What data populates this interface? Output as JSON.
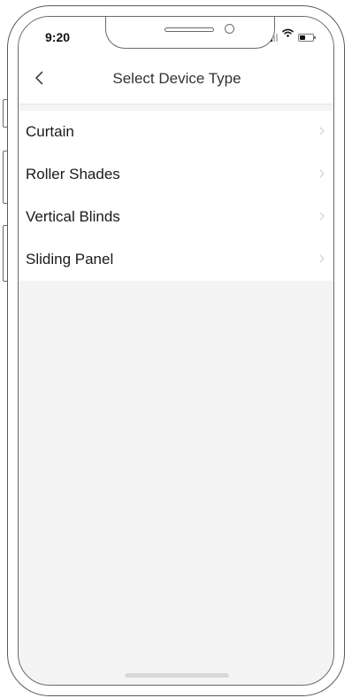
{
  "status_bar": {
    "time": "9:20",
    "icons": [
      "cellular-signal-icon",
      "wifi-icon",
      "battery-icon"
    ],
    "battery_level": 0.45
  },
  "nav": {
    "back_icon": "chevron-left-icon",
    "title": "Select Device Type"
  },
  "device_types": [
    {
      "label": "Curtain",
      "icon": "chevron-right-icon"
    },
    {
      "label": "Roller Shades",
      "icon": "chevron-right-icon"
    },
    {
      "label": "Vertical Blinds",
      "icon": "chevron-right-icon"
    },
    {
      "label": "Sliding Panel",
      "icon": "chevron-right-icon"
    }
  ],
  "colors": {
    "background": "#f4f4f4",
    "surface": "#ffffff",
    "text": "#1a1a1a",
    "frame": "#5a5a5a"
  }
}
